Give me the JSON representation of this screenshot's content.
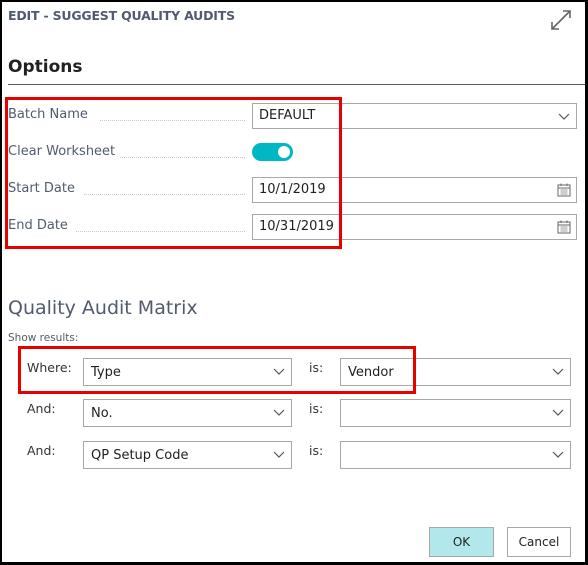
{
  "dialog": {
    "title": "EDIT - SUGGEST QUALITY AUDITS",
    "expand_icon": "expand-diagonal-arrows-icon"
  },
  "options": {
    "section_title": "Options",
    "fields": [
      {
        "label": "Batch Name",
        "value": "DEFAULT",
        "type": "dropdown",
        "icon": "chevron-down-icon"
      },
      {
        "label": "Clear Worksheet",
        "value": true,
        "type": "toggle"
      },
      {
        "label": "Start Date",
        "value": "10/1/2019",
        "type": "date",
        "icon": "calendar-icon"
      },
      {
        "label": "End Date",
        "value": "10/31/2019",
        "type": "date",
        "icon": "calendar-icon"
      }
    ]
  },
  "matrix": {
    "section_title": "Quality Audit Matrix",
    "show_results_label": "Show results:",
    "filters": [
      {
        "connector": "Where:",
        "field": "Type",
        "operator": "is:",
        "value": "Vendor"
      },
      {
        "connector": "And:",
        "field": "No.",
        "operator": "is:",
        "value": ""
      },
      {
        "connector": "And:",
        "field": "QP Setup Code",
        "operator": "is:",
        "value": ""
      }
    ]
  },
  "buttons": {
    "ok": "OK",
    "cancel": "Cancel"
  },
  "colors": {
    "accent_toggle": "#00b7c3",
    "ok_button": "#b2e8ec",
    "highlight_annotation": "#e60000",
    "label_text": "#505c6d"
  }
}
